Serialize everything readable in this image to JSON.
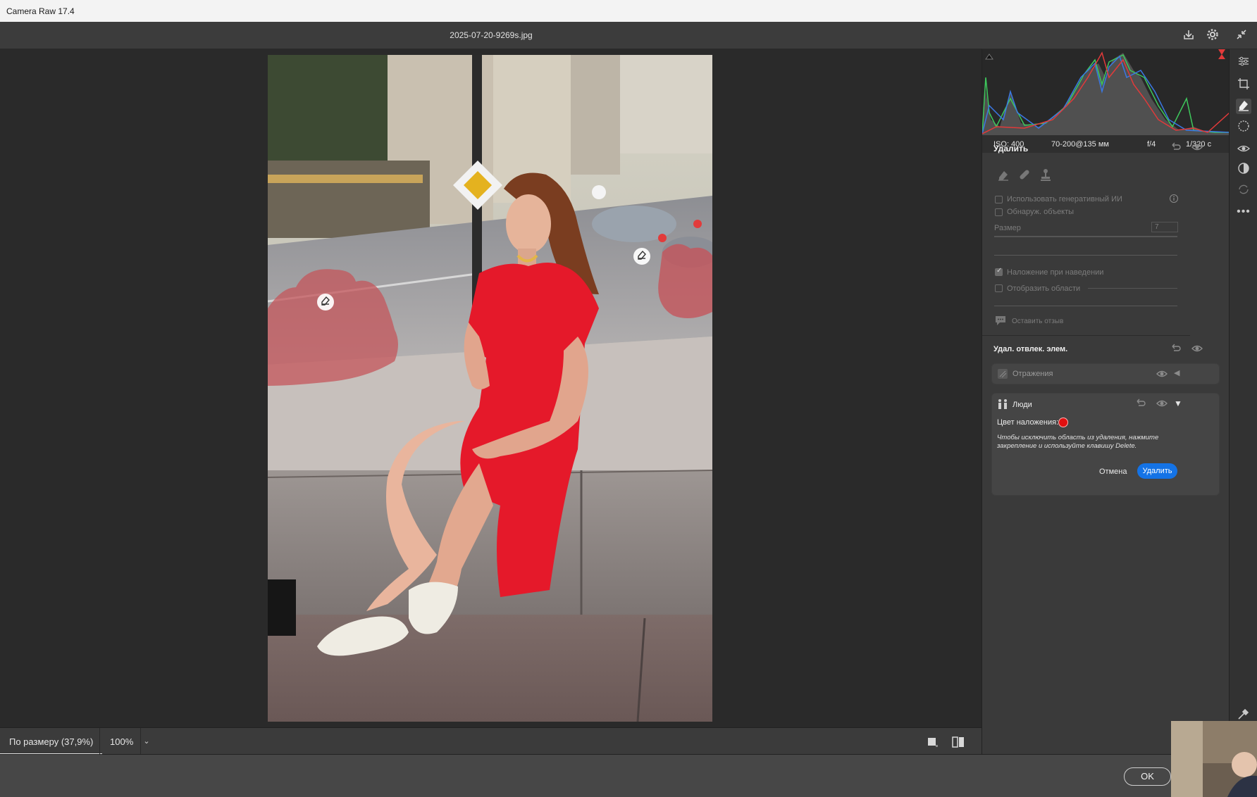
{
  "window": {
    "title": "Camera Raw 17.4"
  },
  "header": {
    "filename": "2025-07-20-9269s.jpg",
    "icons": [
      "save-icon",
      "settings-icon",
      "collapse-icon"
    ]
  },
  "canvas": {
    "zoom_fit_label": "По размеру (37,9%)",
    "zoom_100_label": "100%",
    "overlay_color": "#c84a52"
  },
  "histogram": {
    "exif": {
      "iso": "ISO: 400",
      "lens": "70-200@135 мм",
      "aperture": "f/4",
      "shutter": "1/320 с"
    }
  },
  "remove_panel": {
    "title": "Удалить",
    "use_generative_ai": {
      "label": "Использовать генеративный ИИ",
      "checked": false
    },
    "detect_objects": {
      "label": "Обнаруж. объекты",
      "checked": false
    },
    "size": {
      "label": "Размер",
      "value": "7"
    },
    "overlay_on_hover": {
      "label": "Наложение при наведении",
      "checked": true
    },
    "show_areas": {
      "label": "Отобразить области",
      "checked": false
    },
    "feedback_label": "Оставить отзыв"
  },
  "distractions_panel": {
    "title": "Удал. отвлек. элем.",
    "reflections": {
      "label": "Отражения"
    },
    "people": {
      "label": "Люди",
      "overlay_color_label": "Цвет наложения:",
      "overlay_color": "#e01010",
      "hint": "Чтобы исключить область из удаления, нажмите закрепление и используйте клавишу Delete.",
      "cancel_label": "Отмена",
      "remove_label": "Удалить"
    }
  },
  "footer": {
    "ok_label": "OK"
  },
  "accent": "#1473e6"
}
